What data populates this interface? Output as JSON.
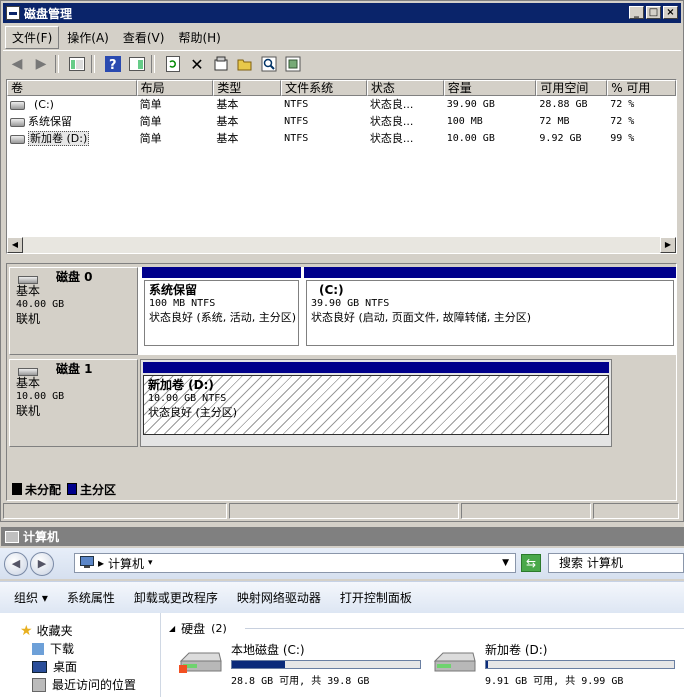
{
  "disk_management": {
    "title": "磁盘管理",
    "menu": [
      "文件(F)",
      "操作(A)",
      "查看(V)",
      "帮助(H)"
    ],
    "columns": [
      "卷",
      "布局",
      "类型",
      "文件系统",
      "状态",
      "容量",
      "可用空间",
      "% 可用"
    ],
    "volumes": [
      {
        "name": "(C:)",
        "layout": "简单",
        "type": "基本",
        "fs": "NTFS",
        "status": "状态良...",
        "capacity": "39.90 GB",
        "free": "28.88 GB",
        "pct": "72 %"
      },
      {
        "name": "系统保留",
        "layout": "简单",
        "type": "基本",
        "fs": "NTFS",
        "status": "状态良...",
        "capacity": "100 MB",
        "free": "72 MB",
        "pct": "72 %"
      },
      {
        "name": "新加卷 (D:)",
        "layout": "简单",
        "type": "基本",
        "fs": "NTFS",
        "status": "状态良...",
        "capacity": "10.00 GB",
        "free": "9.92 GB",
        "pct": "99 %"
      }
    ],
    "disks": [
      {
        "name": "磁盘 0",
        "type": "基本",
        "size": "40.00 GB",
        "state": "联机",
        "partitions": [
          {
            "title": "系统保留",
            "size": "100 MB NTFS",
            "status": "状态良好 (系统, 活动, 主分区)"
          },
          {
            "title": "(C:)",
            "size": "39.90 GB NTFS",
            "status": "状态良好 (启动, 页面文件, 故障转储, 主分区)"
          }
        ]
      },
      {
        "name": "磁盘 1",
        "type": "基本",
        "size": "10.00 GB",
        "state": "联机",
        "partitions": [
          {
            "title": "新加卷  (D:)",
            "size": "10.00 GB NTFS",
            "status": "状态良好 (主分区)"
          }
        ]
      }
    ],
    "legend": {
      "unallocated": "未分配",
      "primary": "主分区"
    },
    "colors": {
      "primary": "#00008b",
      "unallocated": "#000000",
      "titlebar": "#0a246a"
    }
  },
  "explorer": {
    "title": "计算机",
    "address": "计算机",
    "search_placeholder": "搜索 计算机",
    "commands": [
      "组织 ▾",
      "系统属性",
      "卸载或更改程序",
      "映射网络驱动器",
      "打开控制面板"
    ],
    "nav": {
      "favorites": "收藏夹",
      "items": [
        "下载",
        "桌面",
        "最近访问的位置"
      ]
    },
    "group": {
      "title": "硬盘",
      "count": "(2)"
    },
    "drives": [
      {
        "name": "本地磁盘 (C:)",
        "space": "28.8 GB 可用, 共 39.8 GB",
        "used_fraction": 0.28
      },
      {
        "name": "新加卷 (D:)",
        "space": "9.91 GB 可用, 共 9.99 GB",
        "used_fraction": 0.01
      }
    ]
  }
}
